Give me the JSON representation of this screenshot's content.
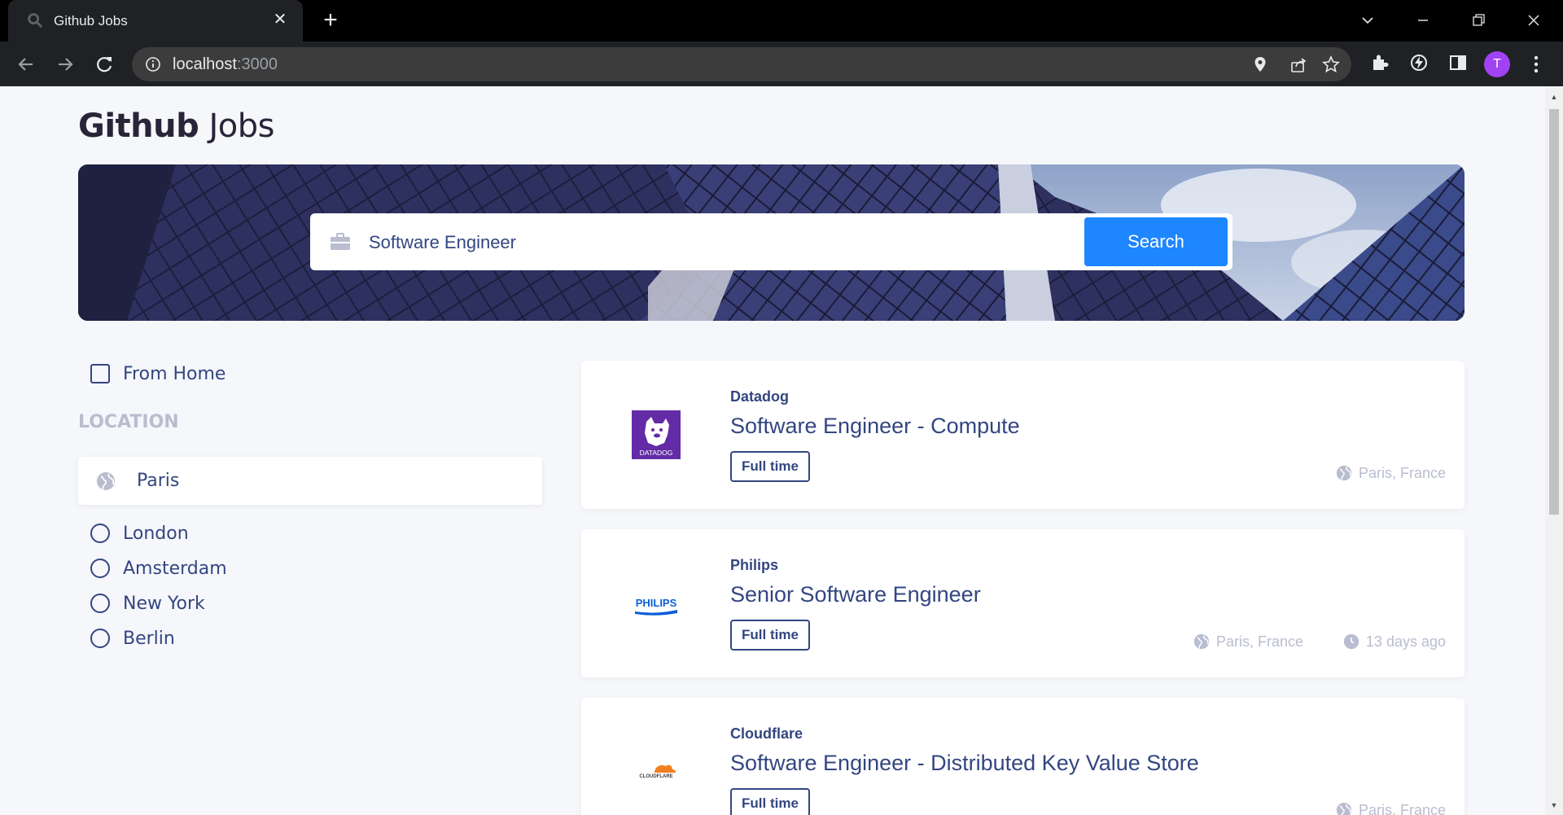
{
  "browser": {
    "tab_title": "Github Jobs",
    "url_host": "localhost",
    "url_port": ":3000",
    "profile_initial": "T"
  },
  "app": {
    "logo_bold": "Github",
    "logo_light": " Jobs"
  },
  "search": {
    "query": "Software Engineer",
    "button_label": "Search"
  },
  "filters": {
    "from_home_label": "From Home",
    "location_title": "LOCATION",
    "location_value": "Paris",
    "location_options": [
      "London",
      "Amsterdam",
      "New York",
      "Berlin"
    ]
  },
  "jobs": [
    {
      "company": "Datadog",
      "title": "Software Engineer - Compute",
      "type": "Full time",
      "location": "Paris, France",
      "posted": ""
    },
    {
      "company": "Philips",
      "title": "Senior Software Engineer",
      "type": "Full time",
      "location": "Paris, France",
      "posted": "13 days ago"
    },
    {
      "company": "Cloudflare",
      "title": "Software Engineer - Distributed Key Value Store",
      "type": "Full time",
      "location": "Paris, France",
      "posted": ""
    }
  ],
  "logos": {
    "datadog_text": "DATADOG",
    "philips_text": "PHILIPS",
    "cloudflare_text": "CLOUDFLARE"
  },
  "colors": {
    "primary": "#1e86ff",
    "text": "#334680",
    "muted": "#b9bdcf",
    "background": "#f6f7fb"
  }
}
